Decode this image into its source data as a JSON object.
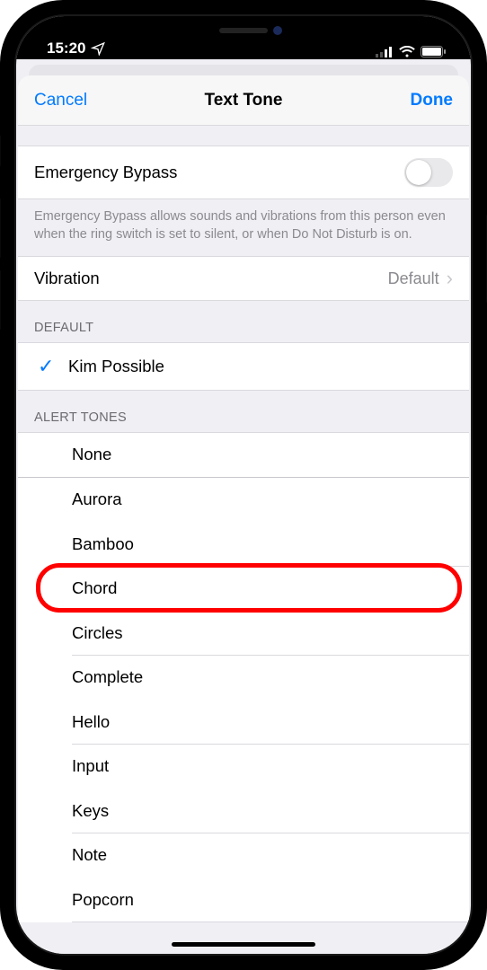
{
  "status": {
    "time": "15:20",
    "location_icon": "navigation-icon"
  },
  "nav": {
    "cancel": "Cancel",
    "title": "Text Tone",
    "done": "Done"
  },
  "emergency": {
    "label": "Emergency Bypass",
    "enabled": false,
    "footer": "Emergency Bypass allows sounds and vibrations from this person even when the ring switch is set to silent, or when Do Not Disturb is on."
  },
  "vibration": {
    "label": "Vibration",
    "value": "Default"
  },
  "default_section": {
    "header": "DEFAULT",
    "selected": "Kim Possible"
  },
  "alert_section": {
    "header": "ALERT TONES",
    "tones": [
      "None",
      "Aurora",
      "Bamboo",
      "Chord",
      "Circles",
      "Complete",
      "Hello",
      "Input",
      "Keys",
      "Note",
      "Popcorn"
    ],
    "highlighted_index": 3
  }
}
